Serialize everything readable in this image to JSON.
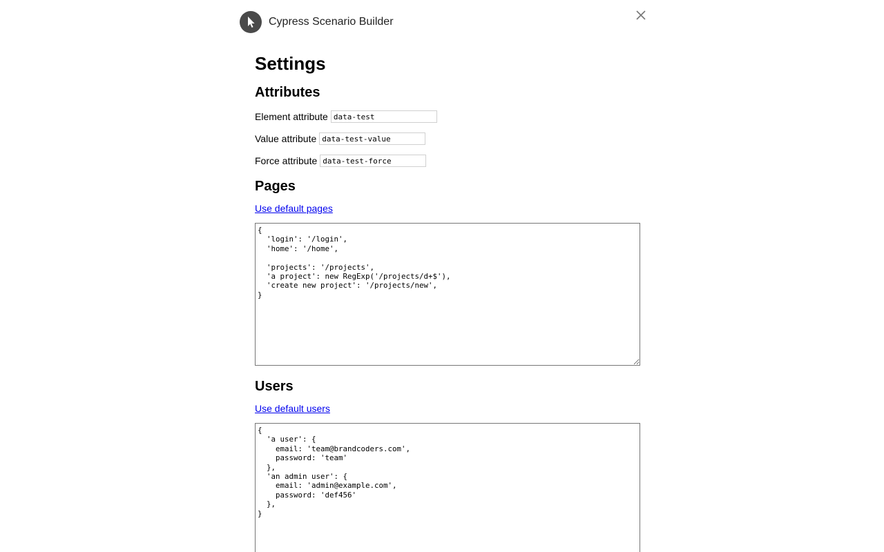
{
  "header": {
    "title": "Cypress Scenario Builder"
  },
  "settings": {
    "title": "Settings",
    "attributes": {
      "title": "Attributes",
      "element_label": "Element attribute",
      "element_value": "data-test",
      "value_label": "Value attribute",
      "value_value": "data-test-value",
      "force_label": "Force attribute",
      "force_value": "data-test-force"
    },
    "pages": {
      "title": "Pages",
      "default_link": "Use default pages",
      "code": "{\n  'login': '/login',\n  'home': '/home',\n\n  'projects': '/projects',\n  'a project': new RegExp('/projects/d+$'),\n  'create new project': '/projects/new',\n}"
    },
    "users": {
      "title": "Users",
      "default_link": "Use default users",
      "code": "{\n  'a user': {\n    email: 'team@brandcoders.com',\n    password: 'team'\n  },\n  'an admin user': {\n    email: 'admin@example.com',\n    password: 'def456'\n  },\n}"
    }
  },
  "icons": {
    "logo": "cursor-arrow-icon",
    "close": "close-icon"
  },
  "colors": {
    "logo_bg": "#4a4a4a",
    "link": "#0000ee"
  }
}
